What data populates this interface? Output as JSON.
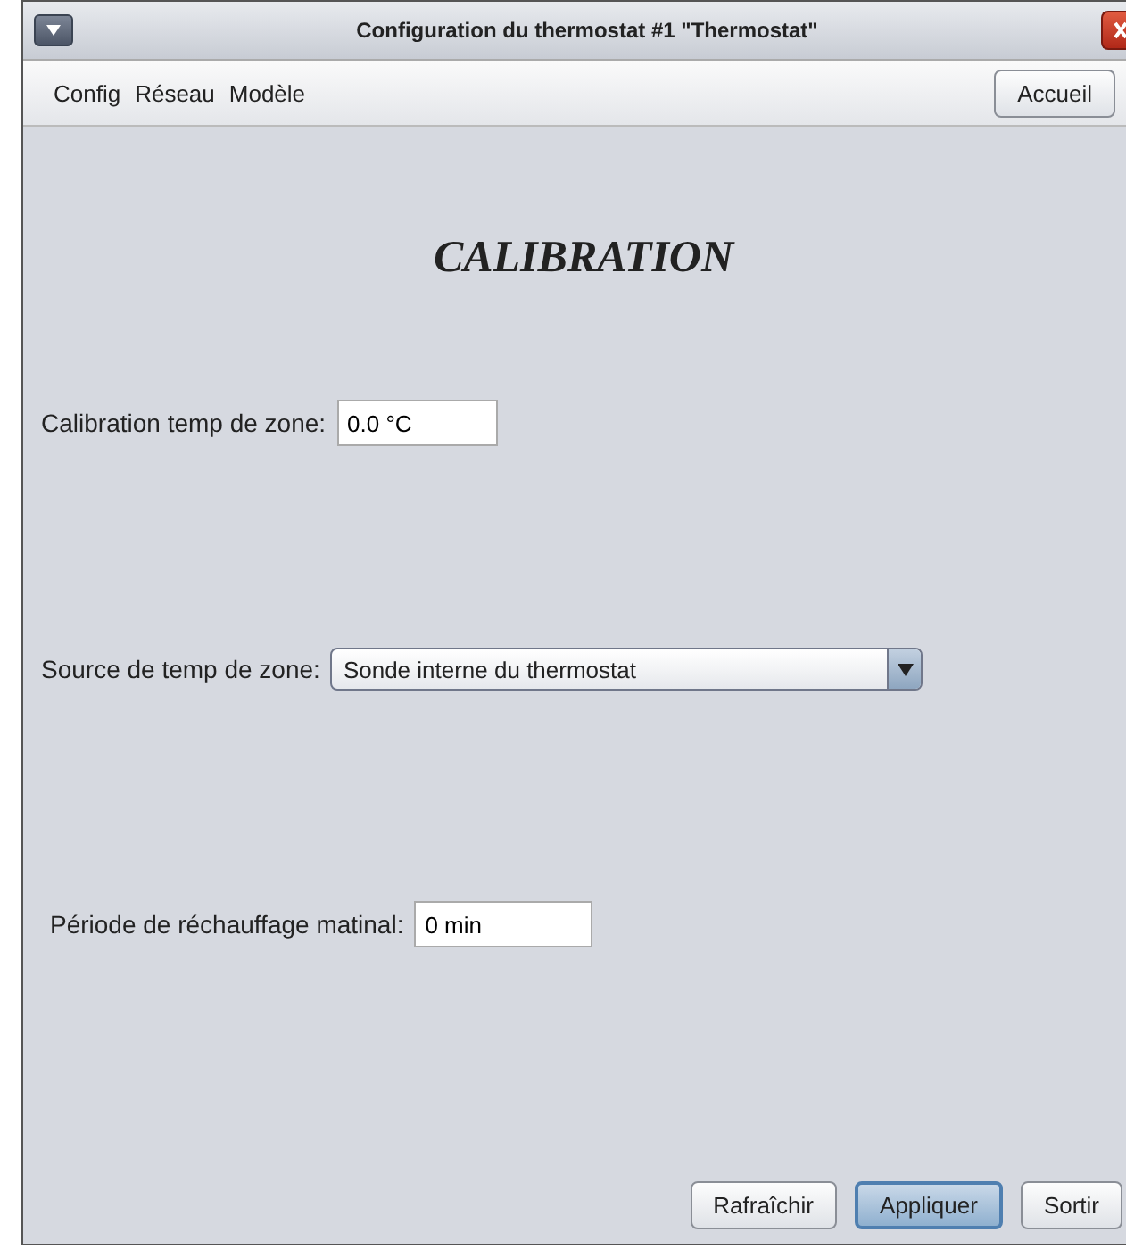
{
  "window": {
    "title": "Configuration du thermostat #1 \"Thermostat\""
  },
  "menu": [
    "Config",
    "Réseau",
    "Modèle"
  ],
  "home_button": "Accueil",
  "heading": "CALIBRATION",
  "fields": [
    {
      "kind": "text",
      "label": "Calibration temp de zone:",
      "value": "0.0 °C"
    },
    {
      "kind": "dropdown",
      "label": "Source de temp de zone:",
      "value": "Sonde interne du thermostat"
    },
    {
      "kind": "text",
      "label": "Période de réchauffage matinal:",
      "value": "0 min"
    }
  ],
  "buttons": [
    {
      "label": "Rafraîchir",
      "default": false
    },
    {
      "label": "Appliquer",
      "default": true
    },
    {
      "label": "Sortir",
      "default": false
    }
  ]
}
